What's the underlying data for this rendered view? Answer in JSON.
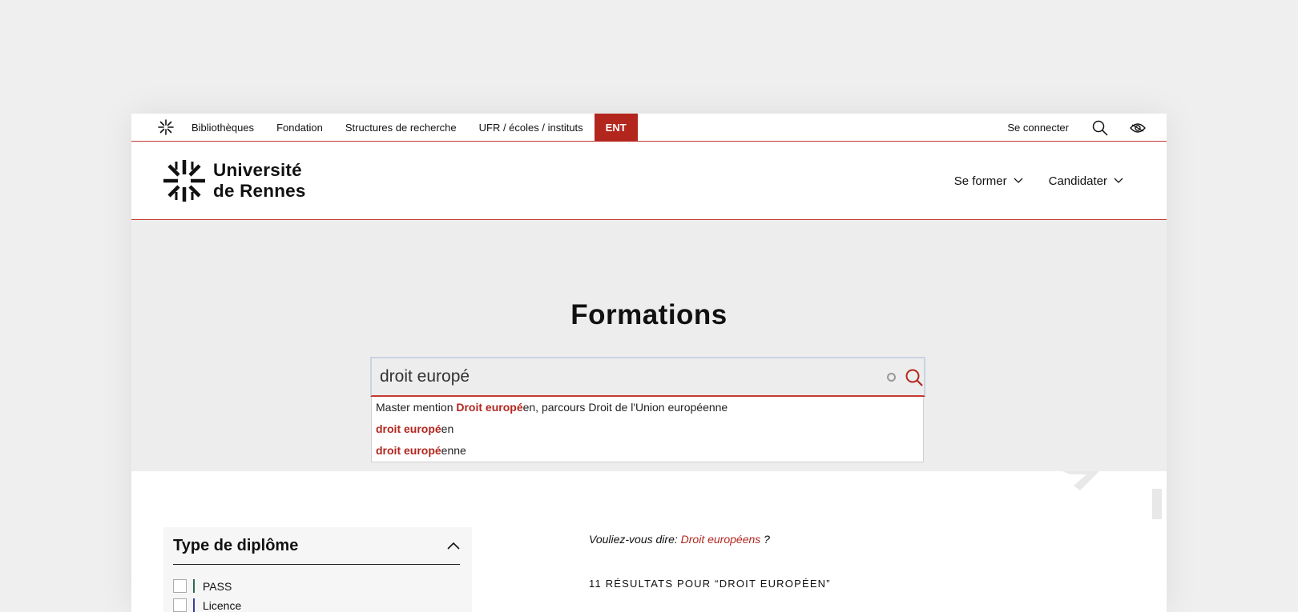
{
  "topbar": {
    "links": [
      "Bibliothèques",
      "Fondation",
      "Structures de recherche",
      "UFR / écoles / instituts"
    ],
    "ent_label": "ENT",
    "connect_label": "Se connecter"
  },
  "header": {
    "logo_line1": "Université",
    "logo_line2": "de Rennes",
    "nav": [
      "Se former",
      "Candidater"
    ]
  },
  "hero": {
    "title": "Formations",
    "search_value": "droit europé"
  },
  "suggestions": [
    {
      "prefix": "Master mention ",
      "match": "Droit europé",
      "suffix": "en, parcours Droit de l'Union européenne"
    },
    {
      "prefix": "",
      "match": "droit europé",
      "suffix": "en"
    },
    {
      "prefix": "",
      "match": "droit europé",
      "suffix": "enne"
    }
  ],
  "filter": {
    "title": "Type de diplôme",
    "options": [
      "PASS",
      "Licence"
    ],
    "option_colors": [
      "#2e6b4f",
      "#3a3a9a"
    ]
  },
  "results": {
    "did_you_mean_label": "Vouliez-vous dire:",
    "did_you_mean_value": "Droit européens",
    "did_you_mean_end": " ?",
    "count_text": "11 RÉSULTATS POUR “DROIT EUROPÉEN”"
  },
  "colors": {
    "accent": "#b3261e",
    "background": "#ededed"
  }
}
